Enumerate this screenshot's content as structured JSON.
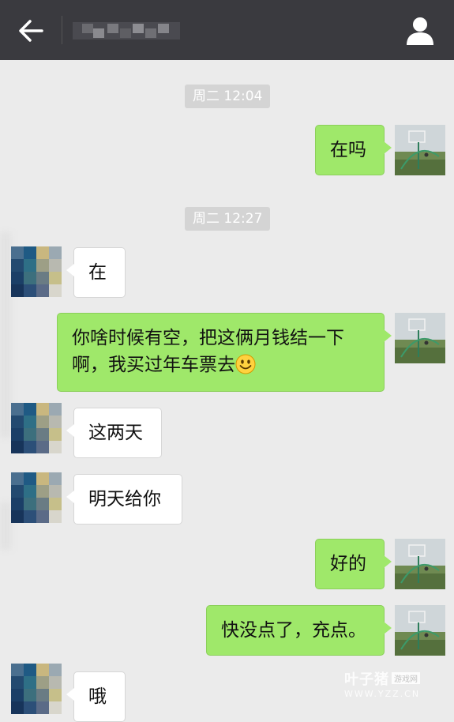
{
  "header": {
    "back_icon": "arrow-left-icon",
    "contact_name_obscured": true,
    "profile_icon": "person-icon"
  },
  "colors": {
    "header_bg": "#3a3a3f",
    "chat_bg": "#ebebeb",
    "my_bubble": "#9fe86a",
    "their_bubble": "#ffffff",
    "timestamp_chip": "#d4d4d4"
  },
  "messages": [
    {
      "type": "time",
      "text": "周二 12:04"
    },
    {
      "type": "sent",
      "text": "在吗"
    },
    {
      "type": "time",
      "text": "周二 12:27"
    },
    {
      "type": "received",
      "text": "在"
    },
    {
      "type": "sent",
      "line1": "你啥时候有空，把这俩月钱结一下",
      "line2": "啊，我买过年车票去",
      "emoji": "smile-emoji"
    },
    {
      "type": "received",
      "text": "这两天"
    },
    {
      "type": "received",
      "text": "明天给你"
    },
    {
      "type": "sent",
      "text": "好的"
    },
    {
      "type": "sent",
      "text": "快没点了，充点。"
    },
    {
      "type": "received",
      "text": "哦"
    }
  ],
  "watermark": {
    "main": "叶子猪",
    "badge": "游戏网",
    "sub": "WWW.YZZ.CN"
  }
}
